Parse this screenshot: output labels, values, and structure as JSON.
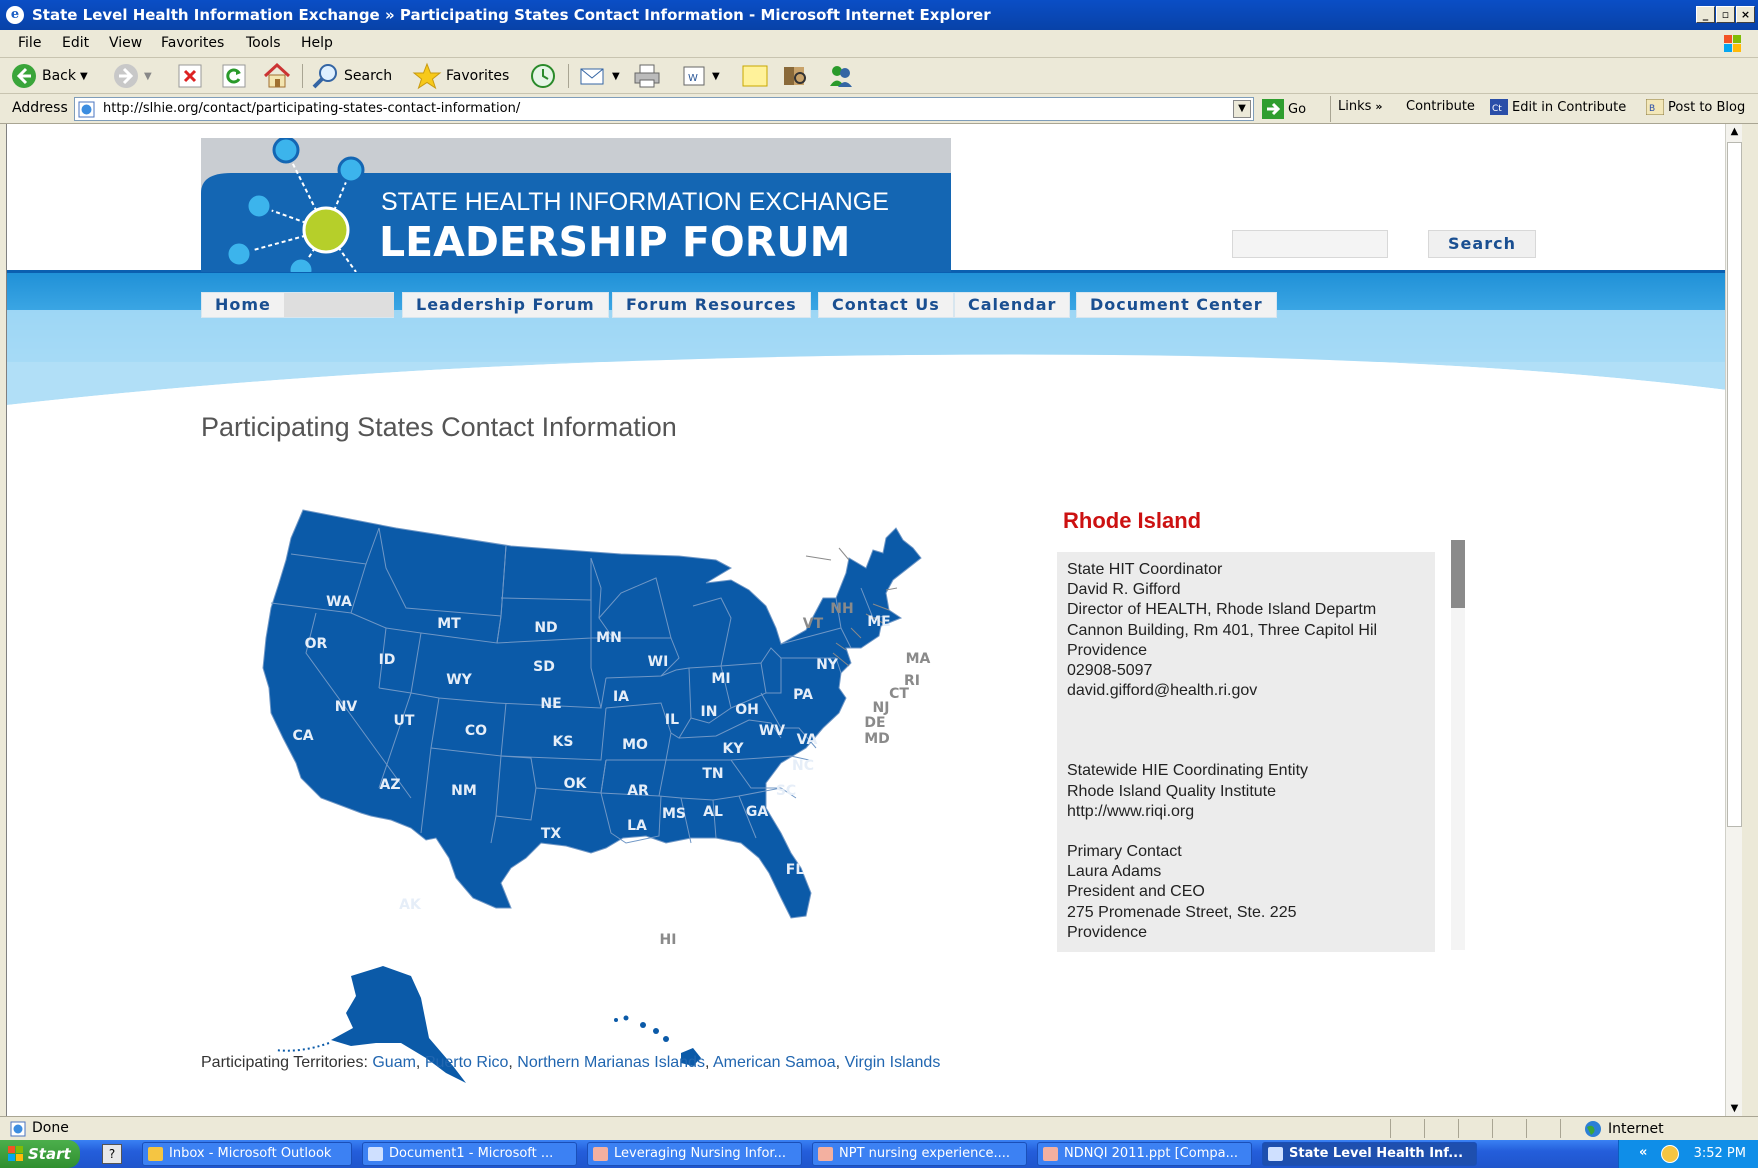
{
  "window": {
    "title": "State Level Health Information Exchange » Participating States Contact Information - Microsoft Internet Explorer"
  },
  "menu": [
    "File",
    "Edit",
    "View",
    "Favorites",
    "Tools",
    "Help"
  ],
  "toolbar": {
    "back": "Back",
    "search": "Search",
    "favorites": "Favorites"
  },
  "address": {
    "label": "Address",
    "url": "http://slhie.org/contact/participating-states-contact-information/",
    "go": "Go",
    "links": "Links",
    "contribute": "Contribute",
    "edit_in_contribute": "Edit in Contribute",
    "post_to_blog": "Post to Blog"
  },
  "site": {
    "banner_line1": "STATE HEALTH INFORMATION EXCHANGE",
    "banner_line2": "LEADERSHIP FORUM",
    "search_button": "Search",
    "nav": [
      "Home",
      "Leadership Forum",
      "Forum Resources",
      "Contact Us",
      "Calendar",
      "Document Center"
    ],
    "page_title": "Participating States Contact Information"
  },
  "map_states": [
    "WA",
    "OR",
    "CA",
    "ID",
    "NV",
    "MT",
    "WY",
    "UT",
    "AZ",
    "CO",
    "NM",
    "ND",
    "SD",
    "NE",
    "KS",
    "OK",
    "TX",
    "MN",
    "IA",
    "MO",
    "AR",
    "LA",
    "WI",
    "IL",
    "MI",
    "IN",
    "KY",
    "TN",
    "MS",
    "AL",
    "GA",
    "FL",
    "SC",
    "NC",
    "VA",
    "WV",
    "OH",
    "PA",
    "NY",
    "VT",
    "NH",
    "ME",
    "MA",
    "RI",
    "CT",
    "NJ",
    "DE",
    "MD",
    "AK",
    "HI"
  ],
  "contact": {
    "state": "Rhode Island",
    "coordinator": {
      "heading": "State HIT Coordinator",
      "name": "David R. Gifford",
      "title": "Director of HEALTH, Rhode Island Departm",
      "address": "Cannon Building, Rm 401, Three Capitol Hil",
      "city": "Providence",
      "zip": "02908-5097",
      "email": "david.gifford@health.ri.gov"
    },
    "entity": {
      "heading": "Statewide HIE Coordinating Entity",
      "name": "Rhode Island Quality Institute",
      "url": "http://www.riqi.org"
    },
    "primary": {
      "heading": "Primary Contact",
      "name": "Laura Adams",
      "title": "President and CEO",
      "address": "275 Promenade Street, Ste. 225",
      "city": "Providence"
    }
  },
  "territories": {
    "label": "Participating Territories:",
    "items": [
      "Guam",
      "Puerto Rico",
      "Northern Marianas Islands",
      "American Samoa",
      "Virgin Islands"
    ]
  },
  "status": {
    "text": "Done",
    "zone": "Internet"
  },
  "taskbar": {
    "start": "Start",
    "tasks": [
      "Inbox - Microsoft Outlook",
      "Document1 - Microsoft ...",
      "Leveraging Nursing Infor...",
      "NPT nursing experience....",
      "NDNQI 2011.ppt [Compa...",
      "State Level Health Inf..."
    ],
    "clock": "3:52 PM"
  }
}
